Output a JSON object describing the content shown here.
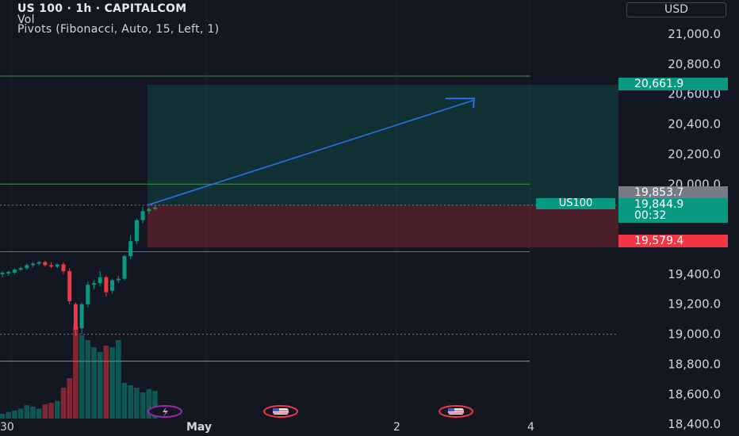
{
  "header": {
    "title": "US 100 · 1h · CAPITALCOM",
    "indicator_vol": "Vol",
    "indicator_pivots": "Pivots (Fibonacci, Auto, 15, Left, 1)"
  },
  "currency_button": "USD",
  "price_axis": {
    "ticks": [
      "21,000.0",
      "20,800.0",
      "20,600.0",
      "20,400.0",
      "20,200.0",
      "20,000.0",
      "19,400.0",
      "19,200.0",
      "19,000.0",
      "18,800.0",
      "18,600.0",
      "18,400.0"
    ]
  },
  "price_tags": {
    "target": "20,661.9",
    "high": "19,853.7",
    "last": "19,844.9",
    "countdown": "00:32",
    "stop": "19,579.4",
    "symbol": "US100"
  },
  "time_axis": [
    "30",
    "May",
    "2",
    "4"
  ],
  "colors": {
    "background": "#131722",
    "up": "#089981",
    "down": "#f23645",
    "arrow": "#2962ff",
    "pivot_green": "#4caf50",
    "pivot_orange": "#f7a21b"
  },
  "chart_data": {
    "type": "candlestick",
    "symbol": "US 100",
    "interval": "1h",
    "ylim": [
      18400,
      21100
    ],
    "pivot_levels": [
      20720,
      20000,
      19550,
      18820
    ],
    "dotted_levels": [
      19860,
      19000
    ],
    "long_position": {
      "entry": 19860,
      "target": 20661.9,
      "stop": 19579.4
    },
    "projection": {
      "from": 19860,
      "to": 20560
    },
    "event_icons": [
      "flash-event-icon",
      "us-flag-event-icon",
      "us-flag-event-icon"
    ],
    "candles": [
      {
        "o": 19400,
        "h": 19420,
        "l": 19380,
        "c": 19410
      },
      {
        "o": 19405,
        "h": 19425,
        "l": 19390,
        "c": 19415
      },
      {
        "o": 19410,
        "h": 19440,
        "l": 19400,
        "c": 19430
      },
      {
        "o": 19430,
        "h": 19450,
        "l": 19420,
        "c": 19440
      },
      {
        "o": 19440,
        "h": 19470,
        "l": 19430,
        "c": 19460
      },
      {
        "o": 19460,
        "h": 19480,
        "l": 19445,
        "c": 19470
      },
      {
        "o": 19470,
        "h": 19490,
        "l": 19460,
        "c": 19480
      },
      {
        "o": 19480,
        "h": 19490,
        "l": 19450,
        "c": 19460
      },
      {
        "o": 19460,
        "h": 19480,
        "l": 19440,
        "c": 19450
      },
      {
        "o": 19450,
        "h": 19470,
        "l": 19440,
        "c": 19465
      },
      {
        "o": 19465,
        "h": 19480,
        "l": 19400,
        "c": 19420
      },
      {
        "o": 19420,
        "h": 19440,
        "l": 19200,
        "c": 19220
      },
      {
        "o": 19200,
        "h": 19210,
        "l": 18990,
        "c": 19030
      },
      {
        "o": 19040,
        "h": 19210,
        "l": 19000,
        "c": 19200
      },
      {
        "o": 19200,
        "h": 19350,
        "l": 19180,
        "c": 19330
      },
      {
        "o": 19330,
        "h": 19360,
        "l": 19300,
        "c": 19340
      },
      {
        "o": 19340,
        "h": 19420,
        "l": 19320,
        "c": 19380
      },
      {
        "o": 19380,
        "h": 19390,
        "l": 19250,
        "c": 19280
      },
      {
        "o": 19290,
        "h": 19370,
        "l": 19270,
        "c": 19360
      },
      {
        "o": 19360,
        "h": 19390,
        "l": 19340,
        "c": 19370
      },
      {
        "o": 19370,
        "h": 19530,
        "l": 19360,
        "c": 19520
      },
      {
        "o": 19520,
        "h": 19660,
        "l": 19500,
        "c": 19620
      },
      {
        "o": 19620,
        "h": 19770,
        "l": 19600,
        "c": 19760
      },
      {
        "o": 19760,
        "h": 19850,
        "l": 19740,
        "c": 19820
      },
      {
        "o": 19820,
        "h": 19845,
        "l": 19800,
        "c": 19835
      },
      {
        "o": 19835,
        "h": 19853.7,
        "l": 19825,
        "c": 19844.9
      }
    ],
    "volume": [
      10,
      14,
      17,
      21,
      28,
      25,
      21,
      30,
      33,
      37,
      65,
      85,
      195,
      175,
      165,
      150,
      140,
      153,
      150,
      165,
      75,
      70,
      65,
      55,
      62,
      58
    ]
  }
}
